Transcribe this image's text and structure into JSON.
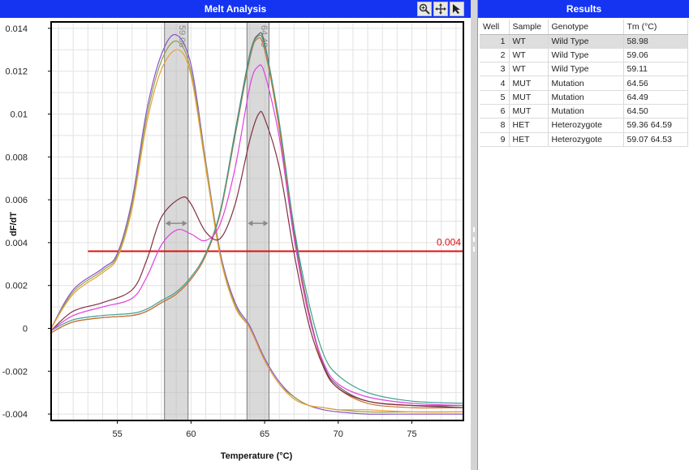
{
  "melt_panel": {
    "title": "Melt Analysis"
  },
  "toolbar": {
    "icons": [
      "zoom-icon",
      "pan-icon",
      "pointer-icon"
    ]
  },
  "results_panel": {
    "title": "Results",
    "columns": [
      "Well",
      "Sample",
      "Genotype",
      "Tm (°C)"
    ],
    "rows": [
      {
        "well": "1",
        "sample": "WT",
        "genotype": "Wild Type",
        "tm": "58.98",
        "selected": true
      },
      {
        "well": "2",
        "sample": "WT",
        "genotype": "Wild Type",
        "tm": "59.06"
      },
      {
        "well": "3",
        "sample": "WT",
        "genotype": "Wild Type",
        "tm": "59.11"
      },
      {
        "well": "4",
        "sample": "MUT",
        "genotype": "Mutation",
        "tm": "64.56"
      },
      {
        "well": "5",
        "sample": "MUT",
        "genotype": "Mutation",
        "tm": "64.49"
      },
      {
        "well": "6",
        "sample": "MUT",
        "genotype": "Mutation",
        "tm": "64.50"
      },
      {
        "well": "8",
        "sample": "HET",
        "genotype": "Heterozygote",
        "tm": "59.36  64.59"
      },
      {
        "well": "9",
        "sample": "HET",
        "genotype": "Heterozygote",
        "tm": "59.07  64.53"
      }
    ]
  },
  "chart_data": {
    "type": "line",
    "title": "",
    "xlabel": "Temperature (°C)",
    "ylabel": "dF/dT",
    "xlim": [
      50.5,
      78.5
    ],
    "ylim": [
      -0.0043,
      0.0143
    ],
    "x_ticks": [
      55,
      60,
      65,
      70,
      75
    ],
    "y_ticks": [
      -0.004,
      -0.002,
      0,
      0.002,
      0.004,
      0.006,
      0.008,
      0.01,
      0.012,
      0.014
    ],
    "y_tick_labels": [
      "-0.004",
      "-0.002",
      "0",
      "0.002",
      "0.004",
      "0.006",
      "0.008",
      "0.01",
      "0.012",
      "0.014"
    ],
    "grid": true,
    "threshold": {
      "value": 0.0036,
      "label": "0.004",
      "x_start": 53,
      "color": "#e01010"
    },
    "peak_regions": [
      {
        "from": 58.2,
        "to": 59.8,
        "label": "59.06"
      },
      {
        "from": 63.8,
        "to": 65.3,
        "label": "64.49"
      }
    ],
    "series_colors": [
      "#8855cc",
      "#90a050",
      "#e8a030",
      "#606060",
      "#d07030",
      "#40a090",
      "#803040",
      "#e040e0"
    ],
    "series": [
      {
        "well": "1",
        "x": [
          50.5,
          52,
          54,
          55,
          56,
          57,
          58,
          58.98,
          60,
          61,
          62,
          63,
          64,
          65,
          66,
          67,
          68,
          69,
          70,
          72,
          75,
          78.5
        ],
        "values": [
          0.0,
          0.0018,
          0.0028,
          0.0035,
          0.006,
          0.0102,
          0.0128,
          0.0137,
          0.0123,
          0.0078,
          0.0035,
          0.0012,
          0.0001,
          -0.0014,
          -0.0025,
          -0.0032,
          -0.0036,
          -0.0038,
          -0.0039,
          -0.004,
          -0.004,
          -0.004
        ]
      },
      {
        "well": "2",
        "x": [
          50.5,
          52,
          54,
          55,
          56,
          57,
          58,
          59.06,
          60,
          61,
          62,
          63,
          64,
          65,
          66,
          67,
          68,
          69,
          70,
          72,
          75,
          78.5
        ],
        "values": [
          0.0,
          0.0017,
          0.0027,
          0.0034,
          0.0058,
          0.0099,
          0.0125,
          0.0134,
          0.012,
          0.0077,
          0.0034,
          0.0011,
          0.0,
          -0.0015,
          -0.0026,
          -0.0032,
          -0.0036,
          -0.0037,
          -0.0038,
          -0.0039,
          -0.0039,
          -0.0039
        ]
      },
      {
        "well": "3",
        "x": [
          50.5,
          52,
          54,
          55,
          56,
          57,
          58,
          59.11,
          60,
          61,
          62,
          63,
          64,
          65,
          66,
          67,
          68,
          69,
          70,
          72,
          75,
          78.5
        ],
        "values": [
          0.0,
          0.0016,
          0.0026,
          0.0033,
          0.0056,
          0.0096,
          0.0121,
          0.013,
          0.0118,
          0.0075,
          0.0033,
          0.001,
          0.0,
          -0.0015,
          -0.0026,
          -0.0033,
          -0.0036,
          -0.0037,
          -0.0038,
          -0.0038,
          -0.0039,
          -0.0039
        ]
      },
      {
        "well": "4",
        "x": [
          50.5,
          52,
          54,
          56,
          57,
          58,
          59,
          60,
          61,
          62,
          63,
          64,
          64.56,
          65,
          66,
          67,
          68,
          69,
          70,
          72,
          75,
          78.5
        ],
        "values": [
          -0.0002,
          0.0003,
          0.0005,
          0.0006,
          0.0008,
          0.0012,
          0.0016,
          0.0023,
          0.0034,
          0.0055,
          0.0092,
          0.0128,
          0.0137,
          0.0133,
          0.0095,
          0.0045,
          0.0008,
          -0.0017,
          -0.0027,
          -0.0034,
          -0.0036,
          -0.0036
        ]
      },
      {
        "well": "5",
        "x": [
          50.5,
          52,
          54,
          56,
          57,
          58,
          59,
          60,
          61,
          62,
          63,
          64,
          64.49,
          65,
          66,
          67,
          68,
          69,
          70,
          72,
          75,
          78.5
        ],
        "values": [
          -0.0002,
          0.0003,
          0.0005,
          0.0006,
          0.0008,
          0.0012,
          0.0016,
          0.0023,
          0.0034,
          0.0054,
          0.009,
          0.0126,
          0.0135,
          0.013,
          0.0093,
          0.0043,
          0.0007,
          -0.0018,
          -0.0028,
          -0.0035,
          -0.0037,
          -0.0037
        ]
      },
      {
        "well": "6",
        "x": [
          50.5,
          52,
          54,
          56,
          57,
          58,
          59,
          60,
          61,
          62,
          63,
          64,
          64.5,
          65,
          66,
          67,
          68,
          69,
          70,
          72,
          75,
          78.5
        ],
        "values": [
          -0.0001,
          0.0004,
          0.0006,
          0.0007,
          0.0009,
          0.0013,
          0.0017,
          0.0024,
          0.0035,
          0.0055,
          0.0091,
          0.0127,
          0.0136,
          0.0132,
          0.0096,
          0.0047,
          0.0012,
          -0.0012,
          -0.0022,
          -0.003,
          -0.0034,
          -0.0035
        ]
      },
      {
        "well": "8",
        "x": [
          50.5,
          52,
          54,
          56,
          57,
          58,
          59.36,
          60,
          61,
          62,
          63,
          64,
          64.59,
          65,
          66,
          67,
          68,
          69,
          70,
          72,
          75,
          78.5
        ],
        "values": [
          -0.0001,
          0.0008,
          0.0012,
          0.0018,
          0.0032,
          0.0052,
          0.0061,
          0.0058,
          0.0045,
          0.0042,
          0.0058,
          0.0088,
          0.01,
          0.0098,
          0.0075,
          0.0035,
          0.0002,
          -0.0018,
          -0.0028,
          -0.0034,
          -0.0036,
          -0.0037
        ]
      },
      {
        "well": "9",
        "x": [
          50.5,
          52,
          54,
          56,
          57,
          58,
          59.07,
          60,
          61,
          62,
          63,
          64,
          64.53,
          65,
          66,
          67,
          68,
          69,
          70,
          72,
          75,
          78.5
        ],
        "values": [
          -0.0001,
          0.0006,
          0.001,
          0.0014,
          0.0024,
          0.0039,
          0.0046,
          0.0044,
          0.0041,
          0.0049,
          0.0075,
          0.0113,
          0.0122,
          0.0119,
          0.0089,
          0.0042,
          0.0006,
          -0.0016,
          -0.0026,
          -0.0032,
          -0.0035,
          -0.0036
        ]
      }
    ]
  }
}
